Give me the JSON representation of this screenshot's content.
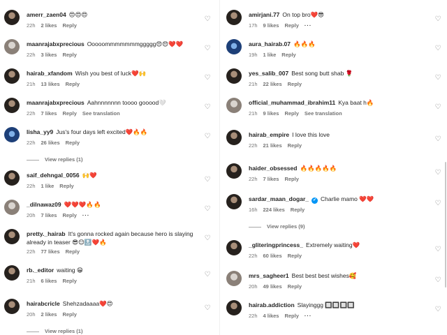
{
  "left": [
    {
      "user": "amerr_zaen04",
      "text": "😍😍😍",
      "meta": [
        "22h",
        "2 likes",
        "Reply"
      ]
    },
    {
      "user": "maanrajabxprecious",
      "text": "Ooooommmmmmmggggg😍😍❤️❤️",
      "meta": [
        "22h",
        "3 likes",
        "Reply"
      ]
    },
    {
      "user": "hairab_xfandom",
      "text": "Wish you best of luck❤️🙌",
      "meta": [
        "21h",
        "13 likes",
        "Reply"
      ]
    },
    {
      "user": "maanrajabxprecious",
      "text": "Aahnnnnnnn toooo gooood🤍",
      "meta": [
        "22h",
        "7 likes",
        "Reply",
        "See translation"
      ]
    },
    {
      "user": "lisha_yy9",
      "text": "Jus's four days left excited❤️🔥🔥",
      "meta": [
        "22h",
        "26 likes",
        "Reply"
      ],
      "replies": "View replies (1)"
    },
    {
      "user": "saif_dehngal_0056",
      "text": "🙌❤️",
      "meta": [
        "22h",
        "1 like",
        "Reply"
      ]
    },
    {
      "user": "_dilnawaz09",
      "text": "❤️❤️❤️🔥🔥",
      "meta": [
        "20h",
        "7 likes",
        "Reply",
        "···"
      ]
    },
    {
      "user": "pretty._hairab",
      "text": "It's gonna rocked again because hero is slaying already in teaser 😎😊🔝❤️🔥",
      "meta": [
        "22h",
        "77 likes",
        "Reply"
      ]
    },
    {
      "user": "rb._editor",
      "text": "waiting 😁",
      "meta": [
        "21h",
        "6 likes",
        "Reply"
      ]
    },
    {
      "user": "hairabcricle",
      "text": "Shehzadaaaa❤️😍",
      "meta": [
        "20h",
        "2 likes",
        "Reply"
      ],
      "replies": "View replies (1)"
    }
  ],
  "right": [
    {
      "user": "amirjani.77",
      "text": "On top bro❤️😎",
      "meta": [
        "17h",
        "9 likes",
        "Reply",
        "···"
      ]
    },
    {
      "user": "aura_hairab.07",
      "text": "🔥🔥🔥",
      "meta": [
        "19h",
        "1 like",
        "Reply"
      ]
    },
    {
      "user": "yes_salib_007",
      "text": "Best song butt shab 🌹",
      "meta": [
        "21h",
        "22 likes",
        "Reply"
      ]
    },
    {
      "user": "official_muhammad_ibrahim11",
      "text": "Kya baat h🔥",
      "meta": [
        "21h",
        "9 likes",
        "Reply",
        "See translation"
      ]
    },
    {
      "user": "hairab_empire",
      "text": "I love this love",
      "meta": [
        "22h",
        "21 likes",
        "Reply"
      ]
    },
    {
      "user": "haider_obsessed",
      "text": "🔥🔥🔥🔥🔥",
      "meta": [
        "22h",
        "7 likes",
        "Reply"
      ]
    },
    {
      "user": "sardar_maan_dogar_",
      "text": "Charlie mamo ❤️❤️",
      "meta": [
        "16h",
        "224 likes",
        "Reply"
      ],
      "verified": true,
      "replies": "View replies (9)"
    },
    {
      "user": "_gliteringprincess_",
      "text": "Extremely waiting❤️",
      "meta": [
        "22h",
        "60 likes",
        "Reply"
      ]
    },
    {
      "user": "mrs_sagheer1",
      "text": "Best best best wishes🥰",
      "meta": [
        "20h",
        "49 likes",
        "Reply"
      ]
    },
    {
      "user": "hairab.addiction",
      "text": "Slayinggg 🔲🔲🔲🔲",
      "meta": [
        "22h",
        "4 likes",
        "Reply",
        "···"
      ]
    }
  ]
}
